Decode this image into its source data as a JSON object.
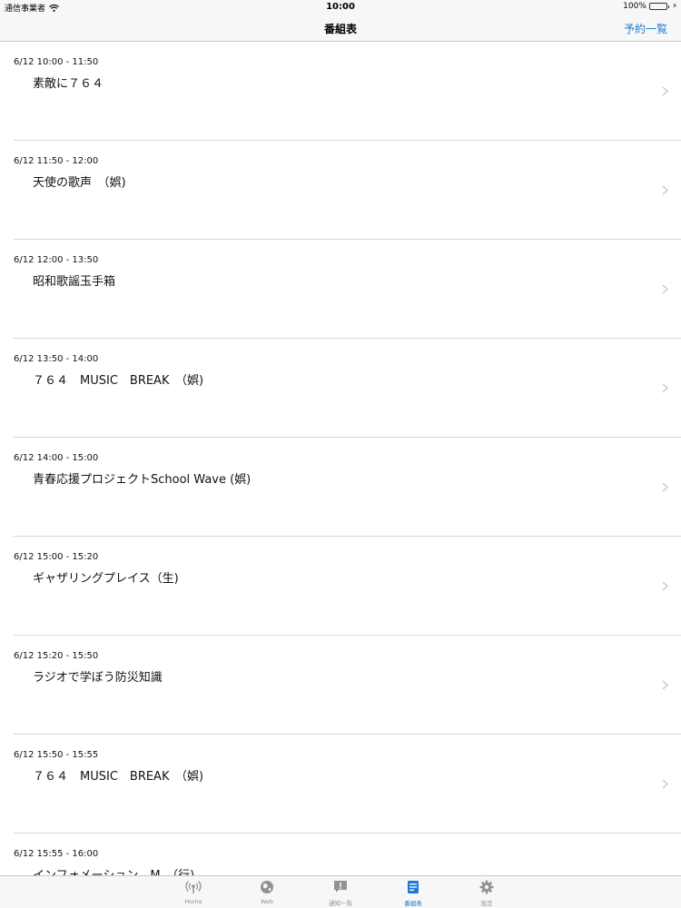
{
  "status_bar": {
    "carrier": "通信事業者",
    "time": "10:00",
    "battery": "100%"
  },
  "nav": {
    "title": "番組表",
    "right_button": "予約一覧"
  },
  "programs": [
    {
      "time": "6/12 10:00 - 11:50",
      "title": "素敵に７６４"
    },
    {
      "time": "6/12 11:50 - 12:00",
      "title": "天使の歌声　（娯)"
    },
    {
      "time": "6/12 12:00 - 13:50",
      "title": "昭和歌謡玉手箱"
    },
    {
      "time": "6/12 13:50 - 14:00",
      "title": "７６４　MUSIC　BREAK　（娯)"
    },
    {
      "time": "6/12 14:00 - 15:00",
      "title": "青春応援プロジェクトSchool Wave (娯)"
    },
    {
      "time": "6/12 15:00 - 15:20",
      "title": "ギャザリングプレイス（生)"
    },
    {
      "time": "6/12 15:20 - 15:50",
      "title": "ラジオで学ぼう防災知識"
    },
    {
      "time": "6/12 15:50 - 15:55",
      "title": "７６４　MUSIC　BREAK　（娯)"
    },
    {
      "time": "6/12 15:55 - 16:00",
      "title": "インフォメーション　M　（行)"
    }
  ],
  "tabs": [
    {
      "label": "Home",
      "icon": "radio-antenna-icon",
      "active": false
    },
    {
      "label": "Web",
      "icon": "globe-icon",
      "active": false
    },
    {
      "label": "通知一覧",
      "icon": "notification-icon",
      "active": false
    },
    {
      "label": "番組表",
      "icon": "program-guide-icon",
      "active": true
    },
    {
      "label": "設定",
      "icon": "gear-icon",
      "active": false
    }
  ],
  "colors": {
    "accent": "#1a7bd8",
    "inactive_tab": "#929292",
    "battery_fill": "#4cd964"
  }
}
